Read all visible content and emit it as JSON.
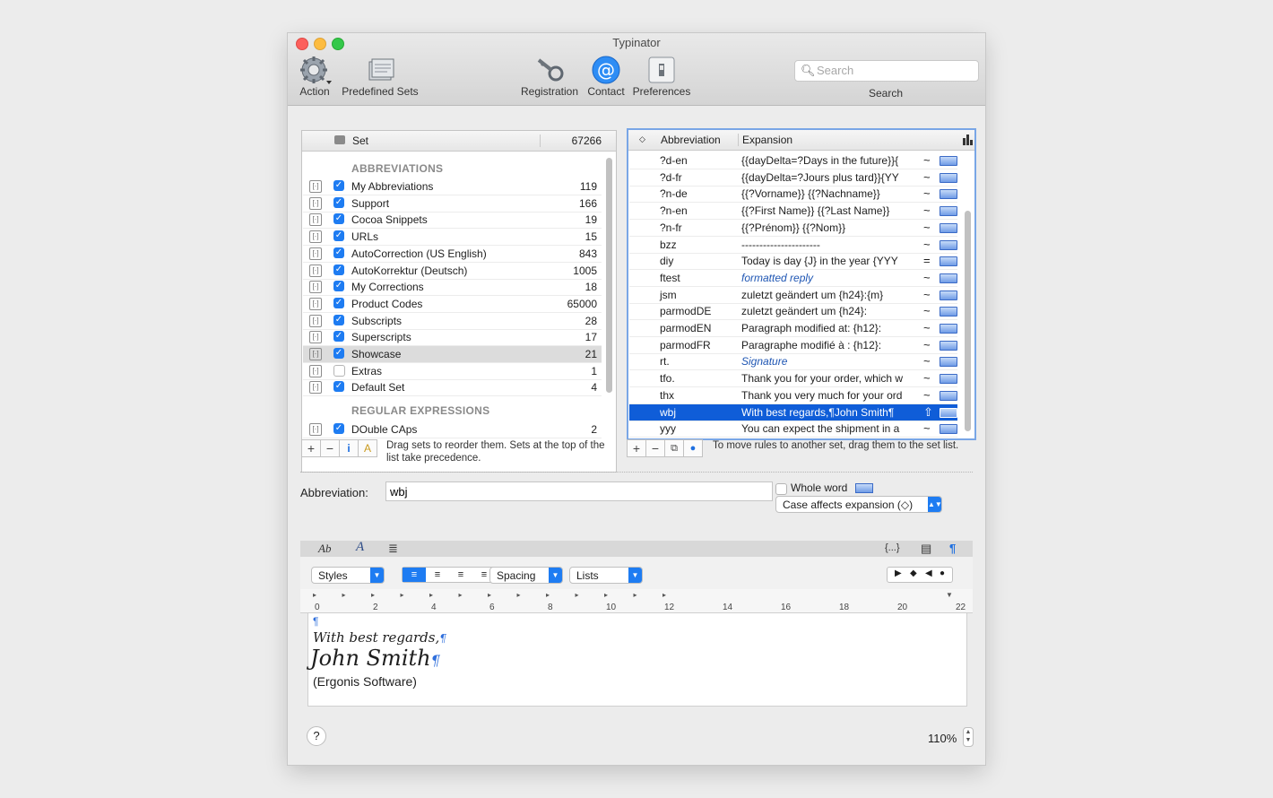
{
  "window": {
    "title": "Typinator"
  },
  "toolbar": {
    "action": "Action",
    "predefined": "Predefined Sets",
    "registration": "Registration",
    "contact": "Contact",
    "preferences": "Preferences",
    "search_placeholder": "Search",
    "search_label": "Search"
  },
  "sets": {
    "header_set": "Set",
    "header_count": "67266",
    "section_abbrev": "ABBREVIATIONS",
    "section_regex": "REGULAR EXPRESSIONS",
    "items": [
      {
        "name": "My Abbreviations",
        "count": "119"
      },
      {
        "name": "Support",
        "count": "166"
      },
      {
        "name": "Cocoa Snippets",
        "count": "19"
      },
      {
        "name": "URLs",
        "count": "15"
      },
      {
        "name": "AutoCorrection (US English)",
        "count": "843"
      },
      {
        "name": "AutoKorrektur (Deutsch)",
        "count": "1005"
      },
      {
        "name": "My Corrections",
        "count": "18"
      },
      {
        "name": "Product Codes",
        "count": "65000"
      },
      {
        "name": "Subscripts",
        "count": "28"
      },
      {
        "name": "Superscripts",
        "count": "17"
      },
      {
        "name": "Showcase",
        "count": "21"
      },
      {
        "name": "Extras",
        "count": "1"
      },
      {
        "name": "Default Set",
        "count": "4"
      }
    ],
    "regex_items": [
      {
        "name": "DOuble CAps",
        "count": "2"
      }
    ],
    "hint": "Drag sets to reorder them. Sets at the top of the list take precedence."
  },
  "rules": {
    "header_abbr": "Abbreviation",
    "header_exp": "Expansion",
    "items": [
      {
        "abbr": "?d-en",
        "exp": "{{dayDelta=?Days in the future}}{",
        "mode": "~"
      },
      {
        "abbr": "?d-fr",
        "exp": "{{dayDelta=?Jours plus tard}}{YY",
        "mode": "~"
      },
      {
        "abbr": "?n-de",
        "exp": "{{?Vorname}} {{?Nachname}}",
        "mode": "~"
      },
      {
        "abbr": "?n-en",
        "exp": "{{?First Name}} {{?Last Name}}",
        "mode": "~"
      },
      {
        "abbr": "?n-fr",
        "exp": "{{?Prénom}} {{?Nom}}",
        "mode": "~"
      },
      {
        "abbr": "bzz",
        "exp": "----------------------",
        "mode": "~"
      },
      {
        "abbr": "diy",
        "exp": "Today is day {J} in the year {YYY",
        "mode": "="
      },
      {
        "abbr": "ftest",
        "exp": "formatted reply",
        "mode": "~"
      },
      {
        "abbr": "jsm",
        "exp": "zuletzt geändert um {h24}:{m}",
        "mode": "~"
      },
      {
        "abbr": "parmodDE",
        "exp": "zuletzt geändert um {h24}:",
        "mode": "~"
      },
      {
        "abbr": "parmodEN",
        "exp": "Paragraph modified at: {h12}:",
        "mode": "~"
      },
      {
        "abbr": "parmodFR",
        "exp": "Paragraphe modifié à : {h12}:",
        "mode": "~"
      },
      {
        "abbr": "rt.",
        "exp": "Signature",
        "mode": "~"
      },
      {
        "abbr": "tfo.",
        "exp": "Thank you for your order, which w",
        "mode": "~"
      },
      {
        "abbr": "thx",
        "exp": "Thank you very much for your ord",
        "mode": "~"
      },
      {
        "abbr": "wbj",
        "exp": "With best regards,¶John  Smith¶",
        "mode": "⇧"
      },
      {
        "abbr": "yyy",
        "exp": "You can expect the shipment in a",
        "mode": "~"
      }
    ],
    "hint": "To move rules to another set, drag them to the set list."
  },
  "editor": {
    "abbr_label": "Abbreviation:",
    "abbr_value": "wbj",
    "whole_word": "Whole word",
    "case_option": "Case affects expansion (◇)",
    "styles": "Styles",
    "spacing": "Spacing",
    "lists": "Lists",
    "ruler_ticks": [
      "0",
      "2",
      "4",
      "6",
      "8",
      "10",
      "12",
      "14",
      "16",
      "18",
      "20",
      "22"
    ],
    "content": {
      "line1": "With best regards,",
      "line2": "John Smith",
      "line3": "(Ergonis Software)"
    },
    "zoom": "110%",
    "help": "?"
  }
}
